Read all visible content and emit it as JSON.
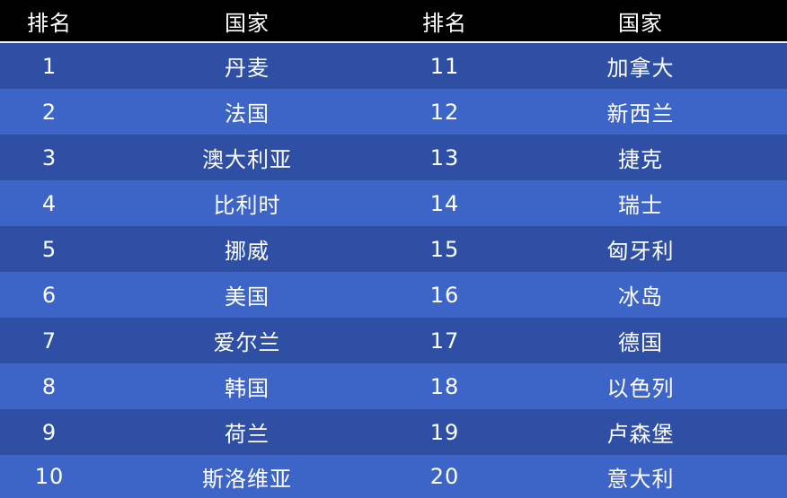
{
  "headers": [
    "排名",
    "国家",
    "排名",
    "国家"
  ],
  "colors": {
    "header_bg": "#000000",
    "row_dark": "#2e4fa3",
    "row_light": "#3d65c8",
    "text": "#ffffff"
  },
  "rows": [
    {
      "rank_a": "1",
      "country_a": "丹麦",
      "rank_b": "11",
      "country_b": "加拿大"
    },
    {
      "rank_a": "2",
      "country_a": "法国",
      "rank_b": "12",
      "country_b": "新西兰"
    },
    {
      "rank_a": "3",
      "country_a": "澳大利亚",
      "rank_b": "13",
      "country_b": "捷克"
    },
    {
      "rank_a": "4",
      "country_a": "比利时",
      "rank_b": "14",
      "country_b": "瑞士"
    },
    {
      "rank_a": "5",
      "country_a": "挪威",
      "rank_b": "15",
      "country_b": "匈牙利"
    },
    {
      "rank_a": "6",
      "country_a": "美国",
      "rank_b": "16",
      "country_b": "冰岛"
    },
    {
      "rank_a": "7",
      "country_a": "爱尔兰",
      "rank_b": "17",
      "country_b": "德国"
    },
    {
      "rank_a": "8",
      "country_a": "韩国",
      "rank_b": "18",
      "country_b": "以色列"
    },
    {
      "rank_a": "9",
      "country_a": "荷兰",
      "rank_b": "19",
      "country_b": "卢森堡"
    },
    {
      "rank_a": "10",
      "country_a": "斯洛维亚",
      "rank_b": "20",
      "country_b": "意大利"
    }
  ]
}
